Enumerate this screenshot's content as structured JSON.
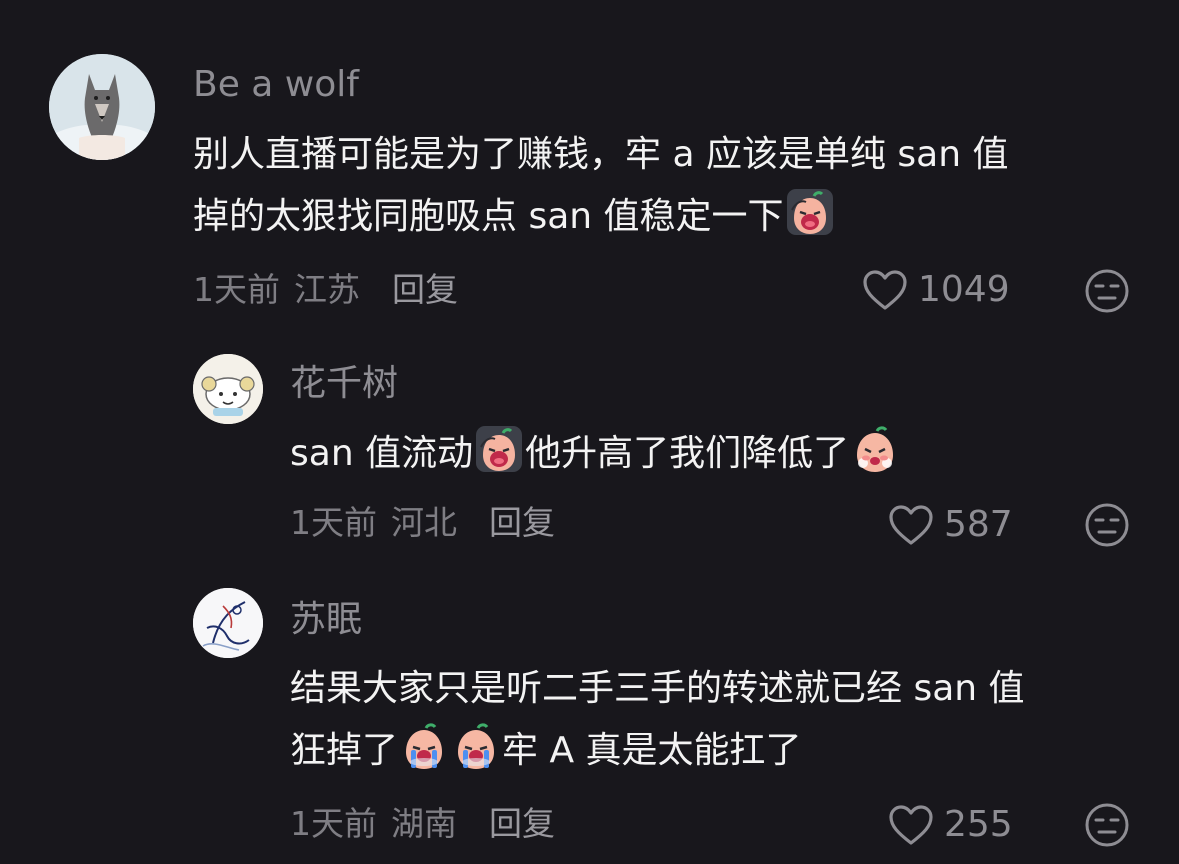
{
  "comments": [
    {
      "username": "Be a wolf",
      "line1": "别人直播可能是为了赚钱，牢 a 应该是单纯 san 值",
      "line2": "掉的太狠找同胞吸点 san 值稳定一下",
      "time": "1天前",
      "location": "江苏",
      "reply": "回复",
      "likes": "1049",
      "avatar": "wolf-avatar"
    },
    {
      "username": "花千树",
      "line1a": "san 值流动",
      "line1b": "他升高了我们降低了",
      "time": "1天前",
      "location": "河北",
      "reply": "回复",
      "likes": "587",
      "avatar": "cartoon-sheep-avatar"
    },
    {
      "username": "苏眠",
      "line1": "结果大家只是听二手三手的转述就已经 san 值",
      "line2a": "狂掉了",
      "line2b": "牢 A 真是太能扛了",
      "time": "1天前",
      "location": "湖南",
      "reply": "回复",
      "likes": "255",
      "avatar": "ink-figure-avatar"
    }
  ],
  "colors": {
    "background": "#18171c",
    "text": "#f3f3f3",
    "muted": "#8e8d93",
    "emoji_face": "#f6b7a3",
    "emoji_dark": "#3a3d44"
  }
}
